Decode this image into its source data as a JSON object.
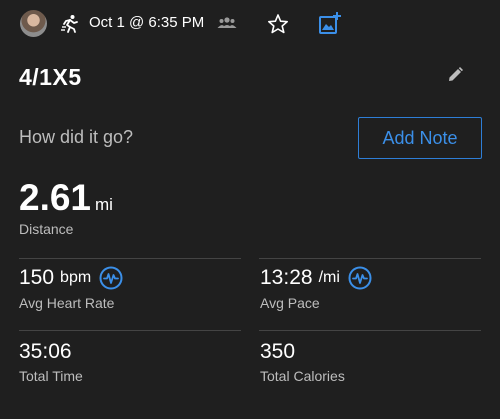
{
  "header": {
    "activity_icon": "running-icon",
    "date_time": "Oct 1 @ 6:35 PM",
    "group_icon": "people-icon",
    "favorite_icon": "star-icon",
    "add_photo_icon": "add-photo-icon"
  },
  "activity": {
    "title": "4/1X5",
    "edit_icon": "pencil-icon"
  },
  "note": {
    "prompt": "How did it go?",
    "button_label": "Add Note"
  },
  "distance": {
    "value": "2.61",
    "unit": "mi",
    "label": "Distance"
  },
  "stats": {
    "heart_rate": {
      "value": "150",
      "unit": "bpm",
      "label": "Avg Heart Rate"
    },
    "pace": {
      "value": "13:28",
      "unit": "/mi",
      "label": "Avg Pace"
    },
    "total_time": {
      "value": "35:06",
      "label": "Total Time"
    },
    "calories": {
      "value": "350",
      "label": "Total Calories"
    }
  },
  "colors": {
    "background": "#1f1f1f",
    "accent": "#3b8fe8",
    "secondary_text": "#bdbdbd",
    "divider": "#444444"
  }
}
